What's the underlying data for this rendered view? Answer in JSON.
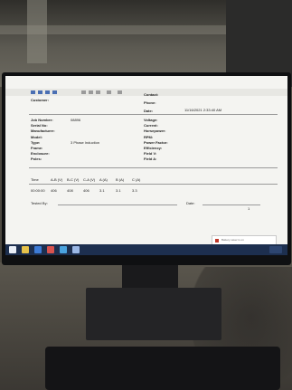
{
  "header": {
    "customer_label": "Customer:",
    "contact_label": "Contact:",
    "phone_label": "Phone:",
    "date_label": "Date:",
    "date_value": "11/16/2021  2:33:40 AM"
  },
  "left_fields": [
    {
      "label": "Job Number:",
      "value": "08896"
    },
    {
      "label": "Serial No:",
      "value": ""
    },
    {
      "label": "Manufacturer:",
      "value": ""
    },
    {
      "label": "Model:",
      "value": ""
    },
    {
      "label": "Type:",
      "value": "3 Phase Induction"
    },
    {
      "label": "Frame:",
      "value": ""
    },
    {
      "label": "Enclosure:",
      "value": ""
    },
    {
      "label": "Poles:",
      "value": ""
    }
  ],
  "right_fields": [
    {
      "label": "Voltage:"
    },
    {
      "label": "Current:"
    },
    {
      "label": "Horsepower:"
    },
    {
      "label": "RPM:"
    },
    {
      "label": "Power Factor:"
    },
    {
      "label": "Efficiency:"
    },
    {
      "label": "Field V:"
    },
    {
      "label": "Field A:"
    }
  ],
  "table": {
    "headers": [
      "Time",
      "A-B (V)",
      "B-C (V)",
      "C-A (V)",
      "A (A)",
      "B (A)",
      "C (A)"
    ],
    "row": [
      "00:00:00",
      "406",
      "408",
      "406",
      "3.1",
      "3.1",
      "3.3"
    ]
  },
  "footer": {
    "tested_by_label": "Tested By:",
    "date_label": "Date:",
    "page_mark": "1"
  },
  "notification": {
    "text": "Battery saver is on"
  },
  "colors": {
    "screen_bg": "#f4f4f1",
    "taskbar": "#1d2f4f",
    "toolbar_icon": "#4a6fb3"
  }
}
